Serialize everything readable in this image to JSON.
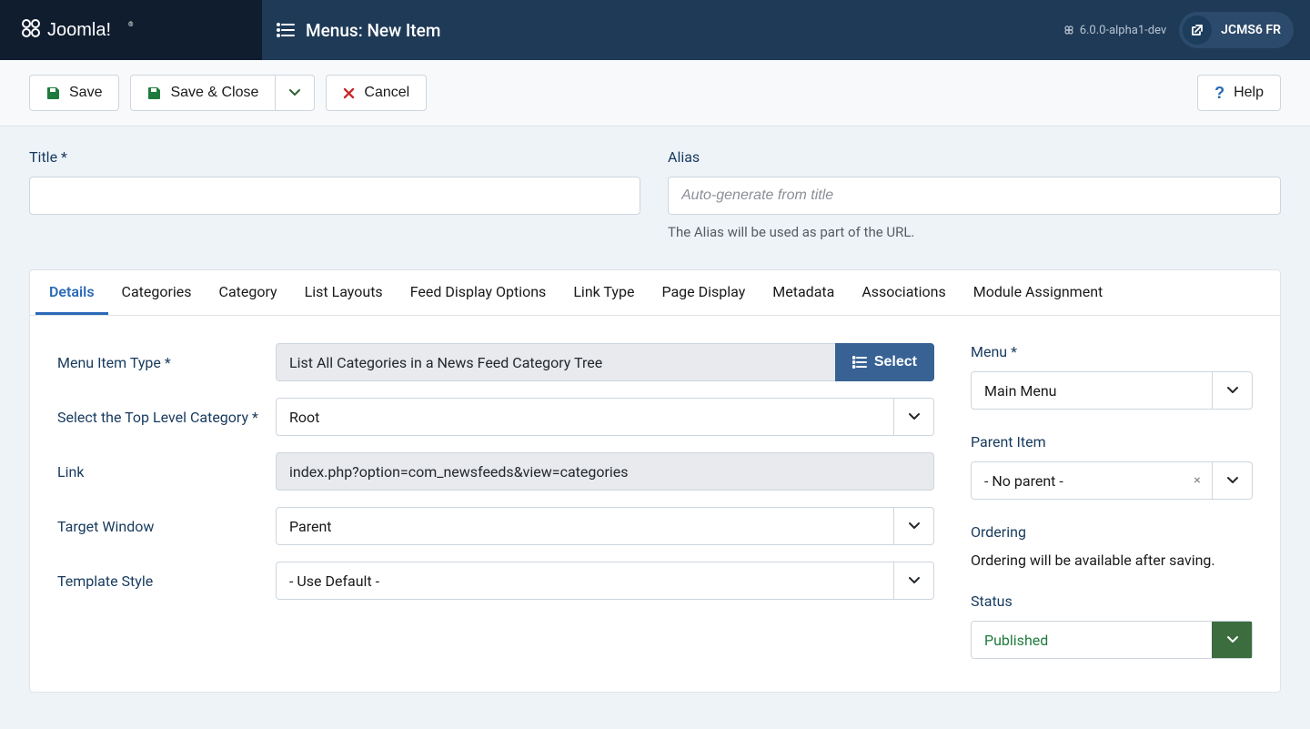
{
  "header": {
    "brand": "Joomla!",
    "page_title": "Menus: New Item",
    "version": "6.0.0-alpha1-dev",
    "site_badge": "JCMS6 FR"
  },
  "toolbar": {
    "save": "Save",
    "save_close": "Save & Close",
    "cancel": "Cancel",
    "help": "Help"
  },
  "title_field": {
    "label": "Title *",
    "value": ""
  },
  "alias_field": {
    "label": "Alias",
    "placeholder": "Auto-generate from title",
    "help": "The Alias will be used as part of the URL."
  },
  "tabs": [
    "Details",
    "Categories",
    "Category",
    "List Layouts",
    "Feed Display Options",
    "Link Type",
    "Page Display",
    "Metadata",
    "Associations",
    "Module Assignment"
  ],
  "active_tab_index": 0,
  "main": {
    "menu_item_type": {
      "label": "Menu Item Type *",
      "value": "List All Categories in a News Feed Category Tree",
      "select_btn": "Select"
    },
    "top_level_category": {
      "label": "Select the Top Level Category *",
      "value": "Root"
    },
    "link": {
      "label": "Link",
      "value": "index.php?option=com_newsfeeds&view=categories"
    },
    "target_window": {
      "label": "Target Window",
      "value": "Parent"
    },
    "template_style": {
      "label": "Template Style",
      "value": "- Use Default -"
    }
  },
  "side": {
    "menu": {
      "label": "Menu *",
      "value": "Main Menu"
    },
    "parent_item": {
      "label": "Parent Item",
      "value": "- No parent -"
    },
    "ordering": {
      "label": "Ordering",
      "text": "Ordering will be available after saving."
    },
    "status": {
      "label": "Status",
      "value": "Published"
    }
  }
}
